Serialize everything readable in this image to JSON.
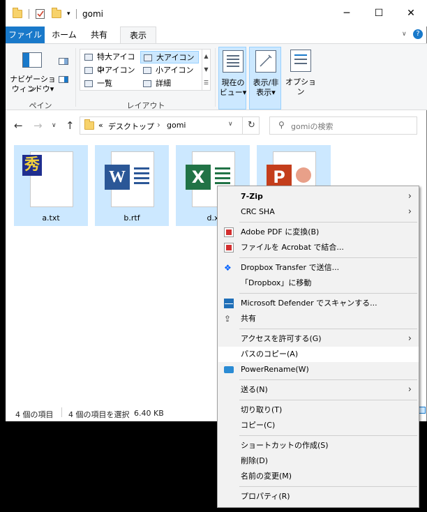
{
  "window": {
    "title": "gomi",
    "controls": {
      "minimize": "─",
      "maximize": "☐",
      "close": "✕"
    }
  },
  "ribbon": {
    "tabs": {
      "file": "ファイル",
      "home": "ホーム",
      "share": "共有",
      "view": "表示"
    },
    "help": "?",
    "panes": {
      "nav_line1": "ナビゲーション",
      "nav_line2": "ウィンドウ▾",
      "group": "ペイン"
    },
    "layout": {
      "group": "レイアウト",
      "extra_large": "特大アイコン",
      "large": "大アイコン",
      "medium": "中アイコン",
      "small": "小アイコン",
      "list": "一覧",
      "details": "詳細"
    },
    "current_view": {
      "line1": "現在の",
      "line2": "ビュー▾"
    },
    "show_hide": {
      "line1": "表示/非",
      "line2": "表示▾"
    },
    "options": "オプション"
  },
  "address": {
    "prefix": "«",
    "crumb1": "デスクトップ",
    "separator": "›",
    "crumb2": "gomi",
    "search_placeholder": "gomiの検索"
  },
  "files": [
    {
      "name": "a.txt",
      "type": "txt"
    },
    {
      "name": "b.rtf",
      "type": "word"
    },
    {
      "name": "d.x",
      "type": "excel"
    },
    {
      "name": "",
      "type": "powerpoint"
    }
  ],
  "status": {
    "item_count": "4 個の項目",
    "selected": "4 個の項目を選択",
    "size": "6.40 KB"
  },
  "context_menu": {
    "seven_zip": "7-Zip",
    "crc_sha": "CRC SHA",
    "adobe_pdf": "Adobe PDF に変換(B)",
    "acrobat_combine": "ファイルを Acrobat で結合...",
    "dropbox_transfer": "Dropbox Transfer で送信...",
    "dropbox_move": "「Dropbox」に移動",
    "defender": "Microsoft Defender でスキャンする...",
    "share": "共有",
    "access": "アクセスを許可する(G)",
    "copy_path": "パスのコピー(A)",
    "power_rename": "PowerRename(W)",
    "send_to": "送る(N)",
    "cut": "切り取り(T)",
    "copy": "コピー(C)",
    "create_shortcut": "ショートカットの作成(S)",
    "delete": "削除(D)",
    "rename": "名前の変更(M)",
    "properties": "プロパティ(R)"
  },
  "colors": {
    "accent": "#1979ca",
    "selection": "#cce8ff",
    "menu_bg": "#f2f2f2"
  }
}
